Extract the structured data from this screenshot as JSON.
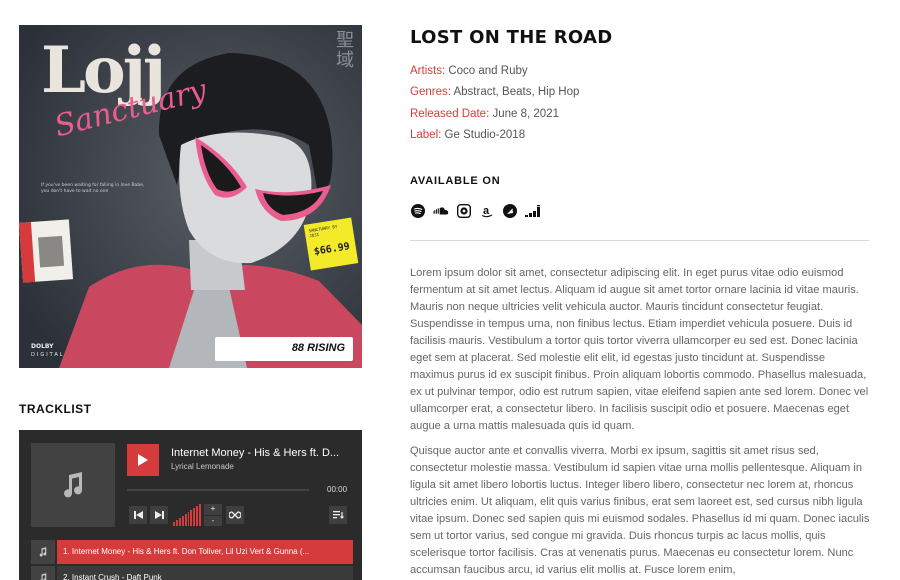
{
  "cover": {
    "title": "Lojj",
    "script": "Sanctuary",
    "kanji": "聖域",
    "small_text": "If you've been waiting for falling in love Babe, you don't have to wait no one",
    "price_top": "SANCTUARY BY JOJI",
    "price": "$66.99",
    "dolby": "DOLBY",
    "digital": "DIGITAL",
    "badge": "88 RISING"
  },
  "tracklist": {
    "title": "TRACKLIST"
  },
  "player": {
    "now_playing_title": "Internet Money - His & Hers ft. D...",
    "now_playing_artist": "Lyrical Lemonade",
    "time": "00:00",
    "volume_plus": "+",
    "volume_minus": "-",
    "tracks": [
      {
        "label": "1. Internet Money - His & Hers ft. Don Toliver, Lil Uzi Vert & Gunna (..."
      },
      {
        "label": "2. Instant Crush - Daft Punk"
      }
    ],
    "colors": {
      "accent": "#d63b3b",
      "bg": "#2b2b2b"
    }
  },
  "album": {
    "title": "LOST ON THE ROAD",
    "artists_label": "Artists:",
    "artists_value": "Coco and Ruby",
    "genres_label": "Genres:",
    "genres_value": "Abstract, Beats, Hip Hop",
    "released_label": "Released Date:",
    "released_value": "June 8, 2021",
    "label_label": "Label:",
    "label_value": "Ge Studio-2018"
  },
  "available_on": {
    "title": "AVAILABLE ON",
    "stores": [
      "spotify-icon",
      "soundcloud-icon",
      "itunes-icon",
      "amazon-icon",
      "napster-icon",
      "deezer-icon"
    ]
  },
  "description": {
    "p1": "Lorem ipsum dolor sit amet, consectetur adipiscing elit. In eget purus vitae odio euismod fermentum at sit amet lectus. Aliquam id augue sit amet tortor ornare lacinia id vitae mauris. Mauris non neque ultricies velit vehicula auctor. Mauris tincidunt consectetur feugiat. Suspendisse in tempus urna, non finibus lectus. Etiam imperdiet vehicula posuere. Duis id facilisis mauris. Vestibulum a tortor quis tortor viverra ullamcorper eu sed est. Donec lacinia eget sem at placerat. Sed molestie elit elit, id egestas justo tincidunt at. Suspendisse maximus purus id ex suscipit finibus. Proin aliquam lobortis commodo. Phasellus malesuada, ex ut pulvinar tempor, odio est rutrum sapien, vitae eleifend sapien ante sed lorem. Donec vel ullamcorper erat, a consectetur libero. In facilisis suscipit odio et posuere. Maecenas eget augue a urna mattis malesuada quis id quam.",
    "p2": "Quisque auctor ante et convallis viverra. Morbi ex ipsum, sagittis sit amet risus sed, consectetur molestie massa. Vestibulum id sapien vitae urna mollis pellentesque. Aliquam in ligula sit amet libero lobortis luctus. Integer libero libero, consectetur nec lorem at, rhoncus ultricies enim. Ut aliquam, elit quis varius finibus, erat sem laoreet est, sed cursus nibh ligula vitae ipsum. Donec sed sapien quis mi euismod sodales. Phasellus id mi quam. Donec iaculis sem ut tortor varius, sed congue mi gravida. Duis rhoncus turpis ac lacus mollis, quis scelerisque tortor facilisis. Cras at venenatis purus. Maecenas eu consectetur lorem. Nunc accumsan faucibus arcu, id varius elit mollis at. Fusce lorem enim,"
  }
}
